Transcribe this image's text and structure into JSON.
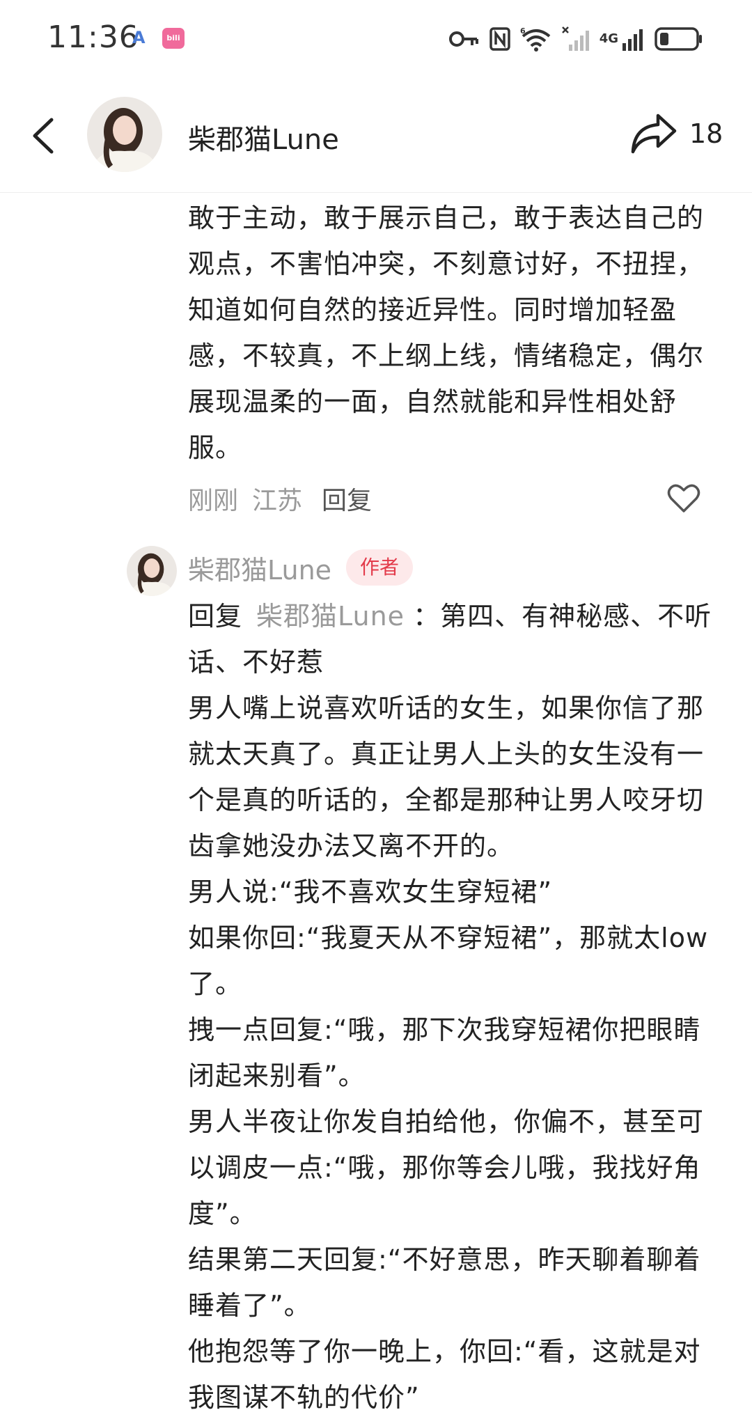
{
  "status_bar": {
    "time": "11:36",
    "network_label": "4G",
    "wifi_badge": "6"
  },
  "header": {
    "username": "柴郡猫Lune",
    "share_count": "18"
  },
  "reply1": {
    "text": "敢于主动，敢于展示自己，敢于表达自己的观点，不害怕冲突，不刻意讨好，不扭捏，知道如何自然的接近异性。同时增加轻盈感，不较真，不上纲上线，情绪稳定，偶尔展现温柔的一面，自然就能和异性相处舒服。",
    "time": "刚刚",
    "location": "江苏",
    "reply_label": "回复"
  },
  "reply2": {
    "username": "柴郡猫Lune",
    "badge": "作者",
    "reply_prefix": "回复",
    "reply_target": "柴郡猫Lune",
    "first_line_rest": "：第四、有神秘感、不听话、不好惹",
    "paragraphs": [
      "男人嘴上说喜欢听话的女生，如果你信了那就太天真了。真正让男人上头的女生没有一个是真的听话的，全都是那种让男人咬牙切齿拿她没办法又离不开的。",
      "男人说:“我不喜欢女生穿短裙”",
      "如果你回:“我夏天从不穿短裙”，那就太low了。",
      "拽一点回复:“哦，那下次我穿短裙你把眼睛闭起来别看”。",
      "男人半夜让你发自拍给他，你偏不，甚至可以调皮一点:“哦，那你等会儿哦，我找好角度”。",
      "结果第二天回复:“不好意思，昨天聊着聊着睡着了”。",
      "他抱怨等了你一晚上，你回:“看，这就是对我图谋不轨的代价”"
    ]
  }
}
